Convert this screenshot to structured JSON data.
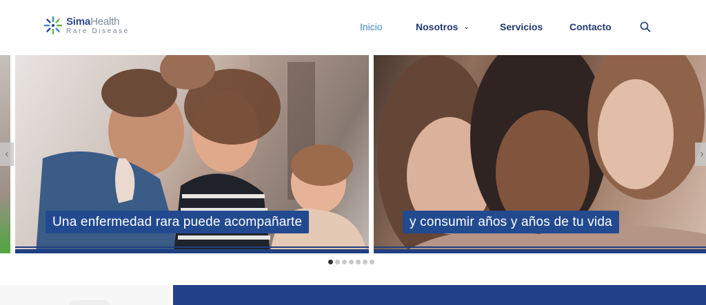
{
  "brand": {
    "name_part1": "Sima",
    "name_part2": "Health",
    "tagline": "Rare Disease"
  },
  "nav": {
    "items": [
      {
        "label": "Inicio",
        "active": true
      },
      {
        "label": "Nosotros",
        "has_dropdown": true
      },
      {
        "label": "Servicios"
      },
      {
        "label": "Contacto"
      }
    ],
    "search_icon": "search-icon"
  },
  "carousel": {
    "slides": [
      {
        "caption": "Una enfermedad rara puede acompañarte"
      },
      {
        "caption": "y consumir años y años de tu vida"
      }
    ],
    "prev_icon": "‹",
    "next_icon": "›",
    "dot_count": 7,
    "active_dot": 0
  },
  "colors": {
    "primary": "#234a8f",
    "accent": "#3d86c6",
    "nav_text": "#1e3a6e"
  }
}
